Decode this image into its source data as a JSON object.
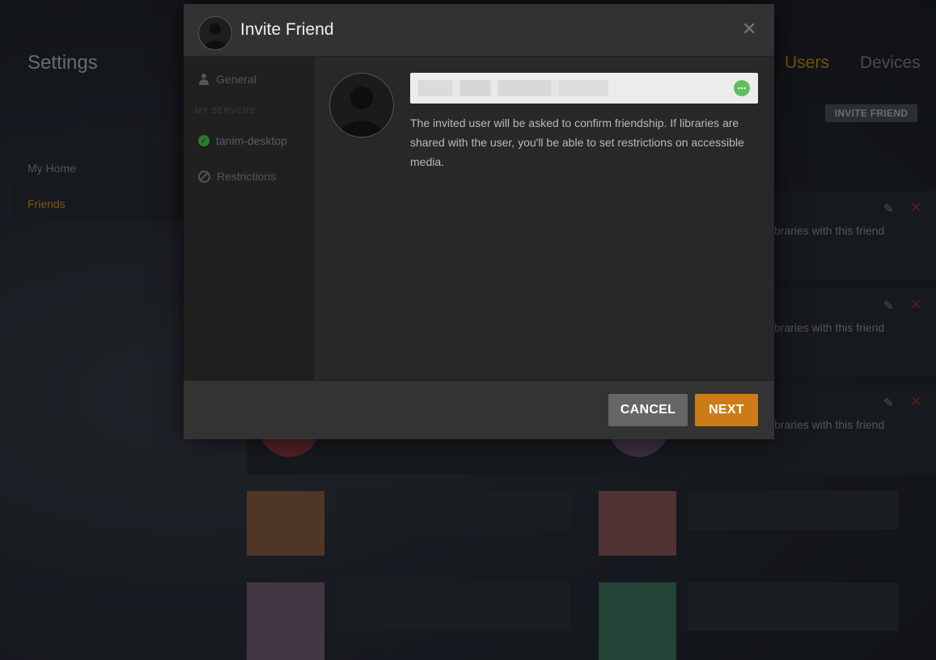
{
  "background": {
    "page_title": "Settings",
    "tabs": [
      {
        "label": "Users",
        "active": true
      },
      {
        "label": "Devices",
        "active": false
      }
    ],
    "sidebar": [
      {
        "label": "My Home",
        "active": false
      },
      {
        "label": "Friends",
        "active": true
      }
    ],
    "invite_button": "INVITE FRIEND",
    "friend_rows": [
      {
        "note": "braries with this friend"
      },
      {
        "note": "braries with this friend"
      },
      {
        "note": "braries with this friend"
      }
    ]
  },
  "modal": {
    "title": "Invite Friend",
    "close_icon": "close-icon",
    "nav": {
      "general": "General",
      "section": "MY SERVERS",
      "server": "tanim-desktop",
      "restrictions": "Restrictions"
    },
    "email_value_blurred": true,
    "hint": "The invited user will be asked to confirm friendship. If libraries are shared with the user, you'll be able to set restrictions on accessible media.",
    "cancel_label": "CANCEL",
    "next_label": "NEXT"
  },
  "colors": {
    "accent": "#cc7b19",
    "cancel": "#666666",
    "status_ok": "#2f7a2f"
  }
}
